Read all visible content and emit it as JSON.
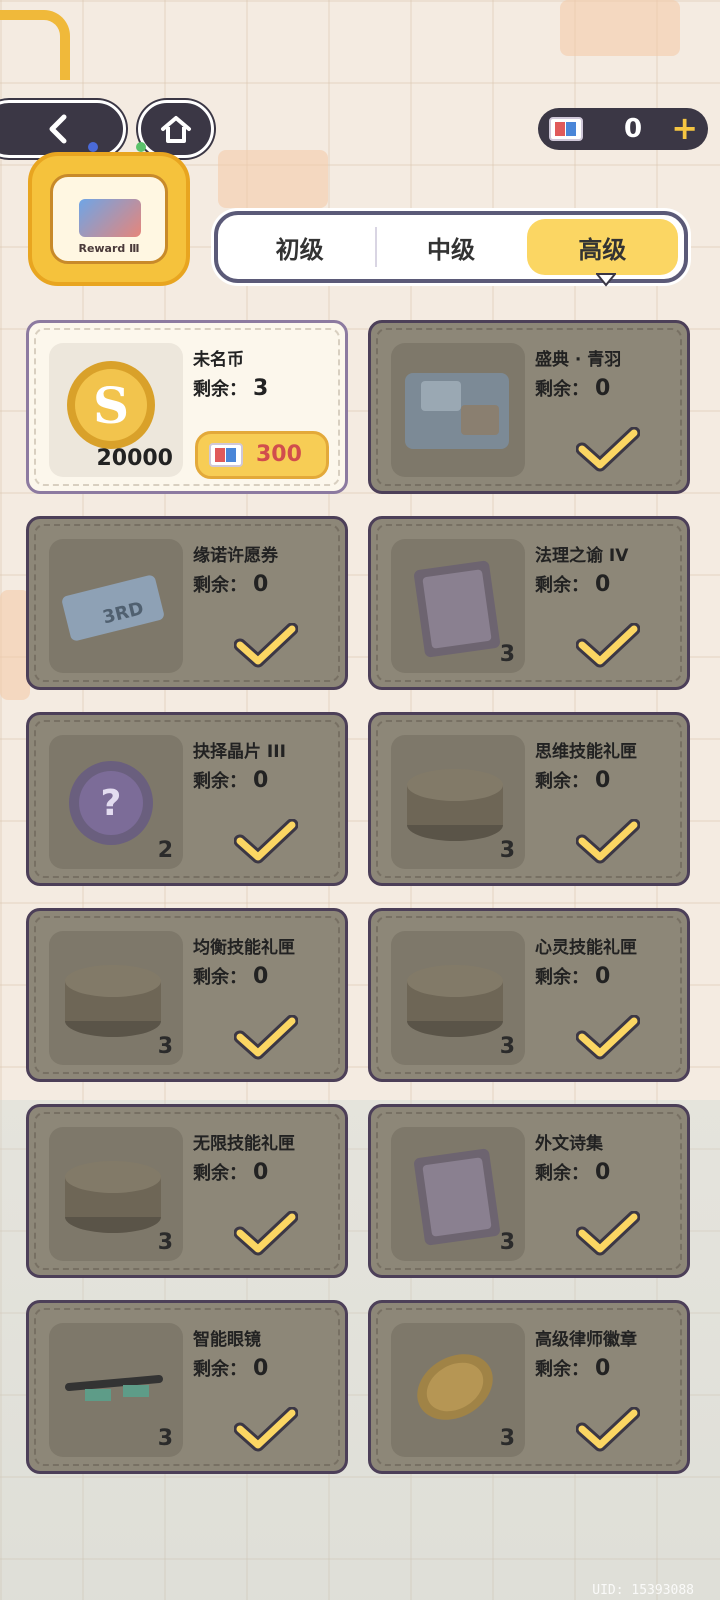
{
  "header": {
    "currency_amount": "0",
    "emblem_label": "Reward Ⅲ"
  },
  "tabs": [
    {
      "label": "初级",
      "active": false
    },
    {
      "label": "中级",
      "active": false
    },
    {
      "label": "高级",
      "active": true
    }
  ],
  "remain_label": "剩余：",
  "items": [
    {
      "name": "未名币",
      "remaining": "3",
      "thumb_count": "20000",
      "price": "300",
      "status": "available",
      "icon": "s-coin-icon"
    },
    {
      "name": "盛典 · 青羽",
      "remaining": "0",
      "thumb_count": "",
      "status": "owned",
      "icon": "gift-box-icon"
    },
    {
      "name": "缘诺许愿券",
      "remaining": "0",
      "thumb_count": "",
      "status": "owned",
      "icon": "wish-ticket-icon"
    },
    {
      "name": "法理之谕 IV",
      "remaining": "0",
      "thumb_count": "3",
      "status": "owned",
      "icon": "book-icon"
    },
    {
      "name": "抉择晶片 III",
      "remaining": "0",
      "thumb_count": "2",
      "status": "owned",
      "icon": "chip-icon"
    },
    {
      "name": "思维技能礼匣",
      "remaining": "0",
      "thumb_count": "3",
      "status": "owned",
      "icon": "gift-tin-icon"
    },
    {
      "name": "均衡技能礼匣",
      "remaining": "0",
      "thumb_count": "3",
      "status": "owned",
      "icon": "gift-tin-icon"
    },
    {
      "name": "心灵技能礼匣",
      "remaining": "0",
      "thumb_count": "3",
      "status": "owned",
      "icon": "gift-tin-icon"
    },
    {
      "name": "无限技能礼匣",
      "remaining": "0",
      "thumb_count": "3",
      "status": "owned",
      "icon": "gift-tin-icon"
    },
    {
      "name": "外文诗集",
      "remaining": "0",
      "thumb_count": "3",
      "status": "owned",
      "icon": "book-icon"
    },
    {
      "name": "智能眼镜",
      "remaining": "0",
      "thumb_count": "3",
      "status": "owned",
      "icon": "glasses-icon"
    },
    {
      "name": "高级律师徽章",
      "remaining": "0",
      "thumb_count": "3",
      "status": "owned",
      "icon": "badge-icon"
    }
  ],
  "colors": {
    "accent_yellow": "#fbd663",
    "dark_frame": "#4c3f58",
    "price_red": "#d14d4d"
  },
  "footer": {
    "uid": "UID: 15393088"
  }
}
